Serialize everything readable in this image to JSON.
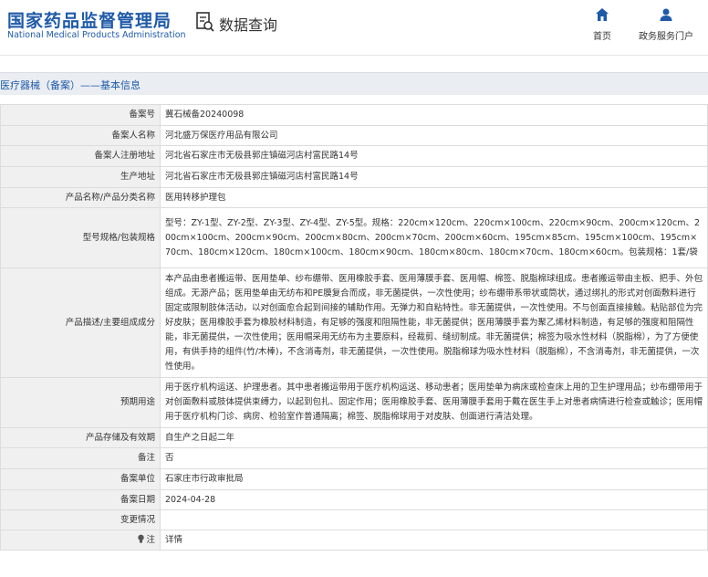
{
  "header": {
    "logo_cn": "国家药品监督管理局",
    "logo_en": "National Medical Products Administration",
    "query_label": "数据查询",
    "nav": [
      {
        "label": "首页",
        "icon": "home-icon"
      },
      {
        "label": "政务服务门户",
        "icon": "user-icon"
      }
    ]
  },
  "breadcrumb": "医疗器械（备案）——基本信息",
  "colors": {
    "brand": "#1e5aa8",
    "label_bg": "#f0f0f0",
    "bar_bg": "#eaedf2"
  },
  "rows": [
    {
      "key": "备案号",
      "value": "冀石械备20240098"
    },
    {
      "key": "备案人名称",
      "value": "河北盛万保医疗用品有限公司"
    },
    {
      "key": "备案人注册地址",
      "value": "河北省石家庄市无极县郭庄镇磁河店村富民路14号"
    },
    {
      "key": "生产地址",
      "value": "河北省石家庄市无极县郭庄镇磁河店村富民路14号"
    },
    {
      "key": "产品名称/产品分类名称",
      "value": "医用转移护理包"
    },
    {
      "key": "型号规格/包装规格",
      "value": "型号：ZY-1型、ZY-2型、ZY-3型、ZY-4型、ZY-5型。规格：220cm×120cm、220cm×100cm、220cm×90cm、200cm×120cm、200cm×100cm、200cm×90cm、200cm×80cm、200cm×70cm、200cm×60cm、195cm×85cm、195cm×100cm、195cm×70cm、180cm×120cm、180cm×100cm、180cm×90cm、180cm×80cm、180cm×70cm、180cm×60cm。包装规格：1套/袋"
    },
    {
      "key": "产品描述/主要组成成分",
      "value": "本产品由患者搬运带、医用垫单、纱布绷带、医用橡胶手套、医用薄膜手套、医用帽、棉签、脱脂棉球组成。患者搬运带由主板、把手、外包组成。无源产品；医用垫单由无纺布和PE膜复合而成，非无菌提供，一次性使用；纱布绷带系带状或筒状，通过绑扎的形式对创面敷料进行固定或限制肢体活动，以对创面愈合起到间接的辅助作用。无弹力和自粘特性。非无菌提供，一次性使用。不与创面直接接触。粘贴部位为完好皮肤；医用橡胶手套为橡胶材料制造，有足够的强度和阻隔性能，非无菌提供；医用薄膜手套为聚乙烯材料制造，有足够的强度和阻隔性能，非无菌提供，一次性使用；医用帽采用无纺布为主要原料，经裁剪、缝纫制成。非无菌提供；棉签为吸水性材料（脱脂棉），为了方便使用，有供手持的组件(竹/木棒)，不含消毒剂，非无菌提供，一次性使用。脱脂棉球为吸水性材料（脱脂棉），不含消毒剂，非无菌提供，一次性使用。"
    },
    {
      "key": "预期用途",
      "value": "用于医疗机构运送、护理患者。其中患者搬运带用于医疗机构运送、移动患者；医用垫单为病床或检查床上用的卫生护理用品；纱布绷带用于对创面敷料或肢体提供束缚力，以起到包扎、固定作用；医用橡胶手套、医用薄膜手套用于戴在医生手上对患者病情进行检查或触诊；医用帽用于医疗机构门诊、病房、检验室作普通隔离；棉签、脱脂棉球用于对皮肤、创面进行清洁处理。"
    },
    {
      "key": "产品存储及有效期",
      "value": "自生产之日起二年"
    },
    {
      "key": "备注",
      "value": "否"
    },
    {
      "key": "备案单位",
      "value": "石家庄市行政审批局"
    },
    {
      "key": "备案日期",
      "value": "2024-04-28"
    },
    {
      "key": "变更情况",
      "value": ""
    },
    {
      "key": "注",
      "value": "详情",
      "icon": "bulb-icon"
    }
  ]
}
